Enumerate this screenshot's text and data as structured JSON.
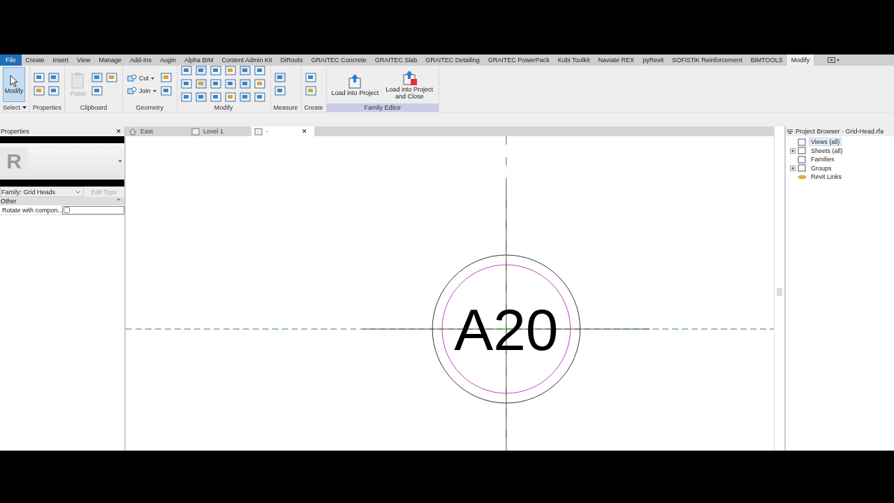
{
  "ribbon_tabs": [
    {
      "label": "File",
      "selected": false,
      "kind": "file"
    },
    {
      "label": "Create",
      "selected": false,
      "kind": "tab"
    },
    {
      "label": "Insert",
      "selected": false,
      "kind": "tab"
    },
    {
      "label": "View",
      "selected": false,
      "kind": "tab"
    },
    {
      "label": "Manage",
      "selected": false,
      "kind": "tab"
    },
    {
      "label": "Add-Ins",
      "selected": false,
      "kind": "tab"
    },
    {
      "label": "Augin",
      "selected": false,
      "kind": "tab"
    },
    {
      "label": "Alpha BIM",
      "selected": false,
      "kind": "tab"
    },
    {
      "label": "Content Admin Kit",
      "selected": false,
      "kind": "tab"
    },
    {
      "label": "DiRoots",
      "selected": false,
      "kind": "tab"
    },
    {
      "label": "GRAITEC Concrete",
      "selected": false,
      "kind": "tab"
    },
    {
      "label": "GRAITEC Slab",
      "selected": false,
      "kind": "tab"
    },
    {
      "label": "GRAITEC Detailing",
      "selected": false,
      "kind": "tab"
    },
    {
      "label": "GRAITEC PowerPack",
      "selected": false,
      "kind": "tab"
    },
    {
      "label": "Kobi Toolkit",
      "selected": false,
      "kind": "tab"
    },
    {
      "label": "Naviate REX",
      "selected": false,
      "kind": "tab"
    },
    {
      "label": "pyRevit",
      "selected": false,
      "kind": "tab"
    },
    {
      "label": "SOFiSTiK Reinforcement",
      "selected": false,
      "kind": "tab"
    },
    {
      "label": "BiMTOOLS",
      "selected": false,
      "kind": "tab"
    },
    {
      "label": "Modify",
      "selected": true,
      "kind": "tab"
    }
  ],
  "ribbon_panels": [
    {
      "title": "Select",
      "contextual": false,
      "tools": [
        {
          "label": "Modify",
          "selected": true
        }
      ]
    },
    {
      "title": "Properties",
      "contextual": false
    },
    {
      "title": "Clipboard",
      "contextual": false,
      "tools": [
        {
          "label": "Paste",
          "disabled": true
        }
      ]
    },
    {
      "title": "Geometry",
      "contextual": false,
      "tools": [
        {
          "label": "Cut"
        },
        {
          "label": "Join"
        }
      ]
    },
    {
      "title": "Modify",
      "contextual": false
    },
    {
      "title": "Measure",
      "contextual": false
    },
    {
      "title": "Create",
      "contextual": false
    },
    {
      "title": "Family Editor",
      "contextual": true,
      "tools": [
        {
          "label": "Load into Project"
        },
        {
          "label": "Load into Project and Close"
        }
      ]
    }
  ],
  "properties": {
    "title": "Properties",
    "close": "✕",
    "logo_letter": "R",
    "family": "Family: Grid Heads",
    "edit_type": {
      "label": "Edit Type",
      "disabled": true
    },
    "group": "Other",
    "collapse": "⌃",
    "rows": [
      {
        "name": "Rotate with compon...",
        "checked": false
      }
    ]
  },
  "view_tabs": [
    {
      "label": "East",
      "selected": false
    },
    {
      "label": "Level 1",
      "selected": false
    },
    {
      "label": "-",
      "selected": true,
      "close": "✕"
    }
  ],
  "canvas": {
    "label": "A20"
  },
  "project_browser": {
    "title": "Project Browser - Grid-Head.rfa",
    "items": [
      {
        "label": "Views (all)",
        "selected": true
      },
      {
        "label": "Sheets (all)",
        "selected": false,
        "expanded": false
      },
      {
        "label": "Families",
        "selected": false
      },
      {
        "label": "Groups",
        "selected": false,
        "expanded": false
      },
      {
        "label": "Revit Links",
        "selected": false
      }
    ]
  }
}
